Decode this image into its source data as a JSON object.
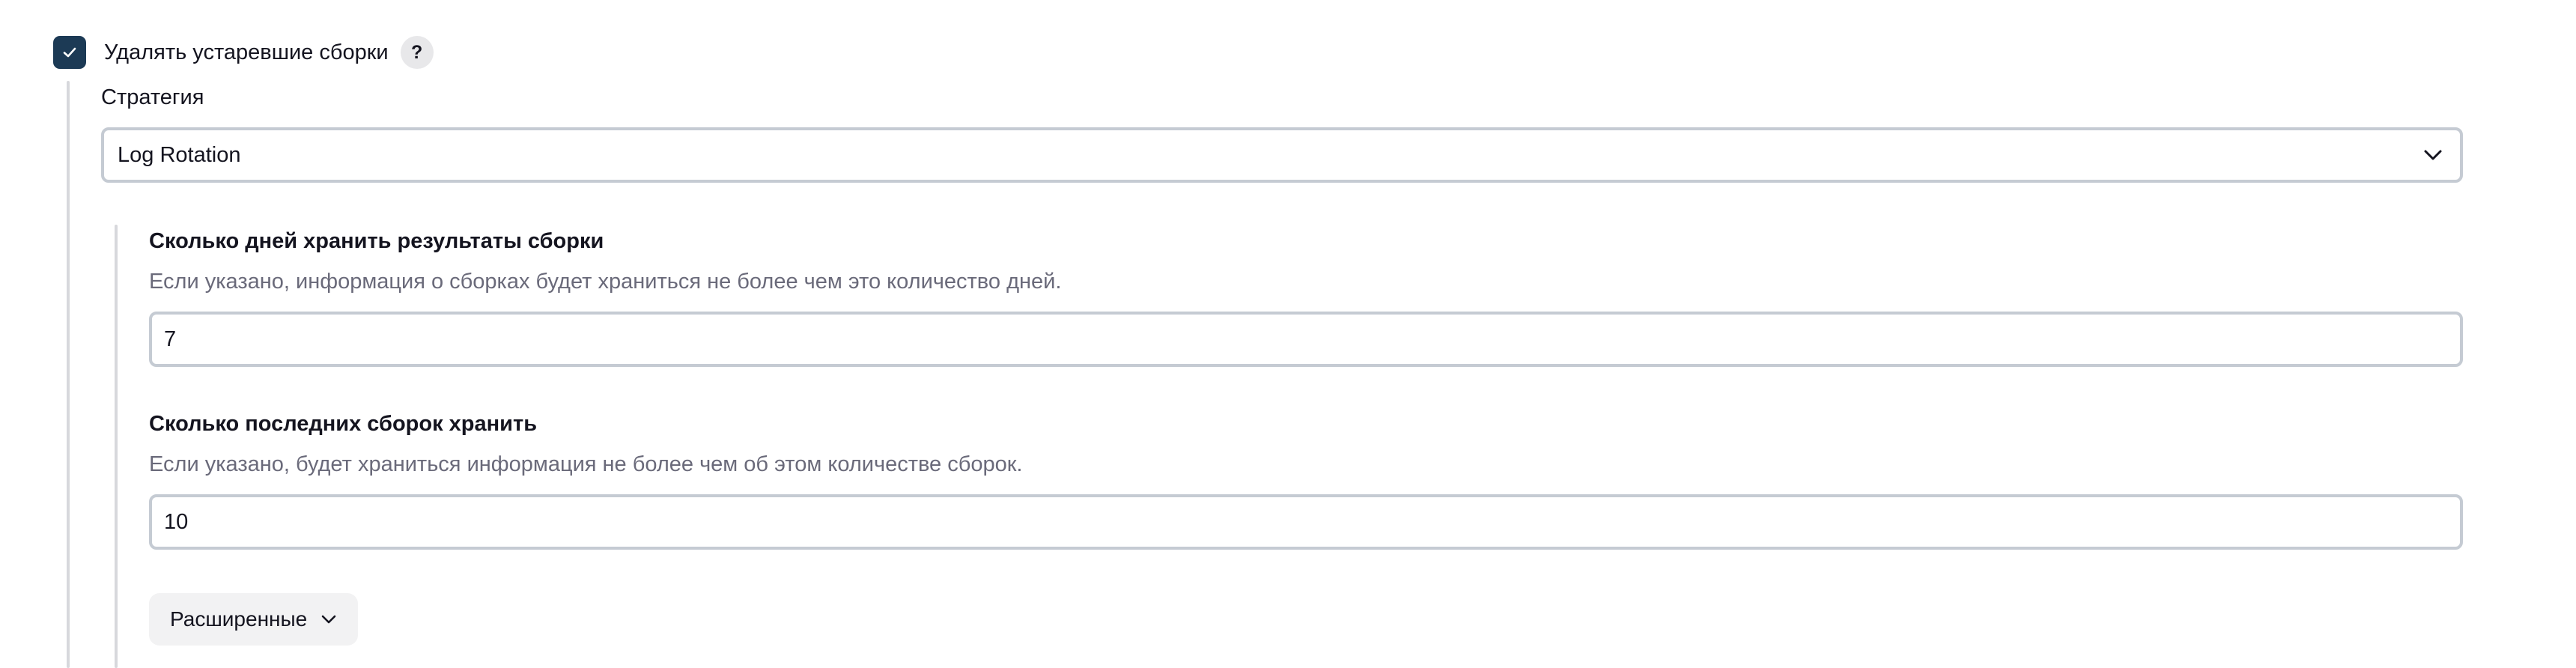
{
  "discard_old_builds": {
    "label": "Удалять устаревшие сборки",
    "checked": true,
    "help_label": "?"
  },
  "strategy": {
    "label": "Стратегия",
    "selected": "Log Rotation"
  },
  "days_to_keep": {
    "title": "Сколько дней хранить результаты сборки",
    "description": "Если указано, информация о сборках будет храниться не более чем это количество дней.",
    "value": "7"
  },
  "num_to_keep": {
    "title": "Сколько последних сборок хранить",
    "description": "Если указано, будет храниться информация не более чем об этом количестве сборок.",
    "value": "10"
  },
  "advanced": {
    "label": "Расширенные"
  },
  "colors": {
    "checkbox_fill": "#1c3a55",
    "input_border": "#c5cbd3",
    "guide_line": "#d7d8dc",
    "description_text": "#6a6a7a"
  },
  "icons": {
    "checkbox": "checkmark-icon",
    "select": "chevron-down-icon",
    "advanced": "chevron-down-icon"
  }
}
